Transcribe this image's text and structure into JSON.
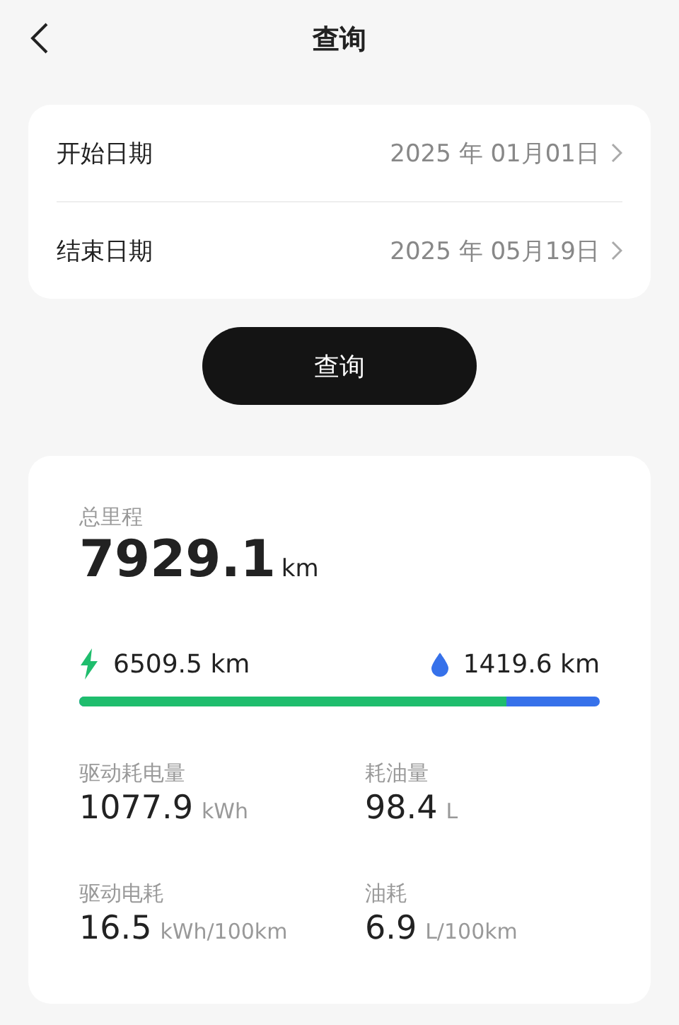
{
  "header": {
    "title": "查询"
  },
  "dates": [
    {
      "label": "开始日期",
      "value": "2025 年 01月01日"
    },
    {
      "label": "结束日期",
      "value": "2025 年 05月19日"
    }
  ],
  "query_button": "查询",
  "summary": {
    "label": "总里程",
    "value": "7929.1",
    "unit": "km",
    "electric": {
      "value": "6509.5 km",
      "level": 0.82
    },
    "fuel": {
      "value": "1419.6 km"
    },
    "stats": [
      {
        "label": "驱动耗电量",
        "value": "1077.9",
        "unit": "kWh"
      },
      {
        "label": "耗油量",
        "value": "98.4",
        "unit": "L"
      },
      {
        "label": "驱动电耗",
        "value": "16.5",
        "unit": "kWh/100km"
      },
      {
        "label": "油耗",
        "value": "6.9",
        "unit": "L/100km"
      }
    ]
  }
}
